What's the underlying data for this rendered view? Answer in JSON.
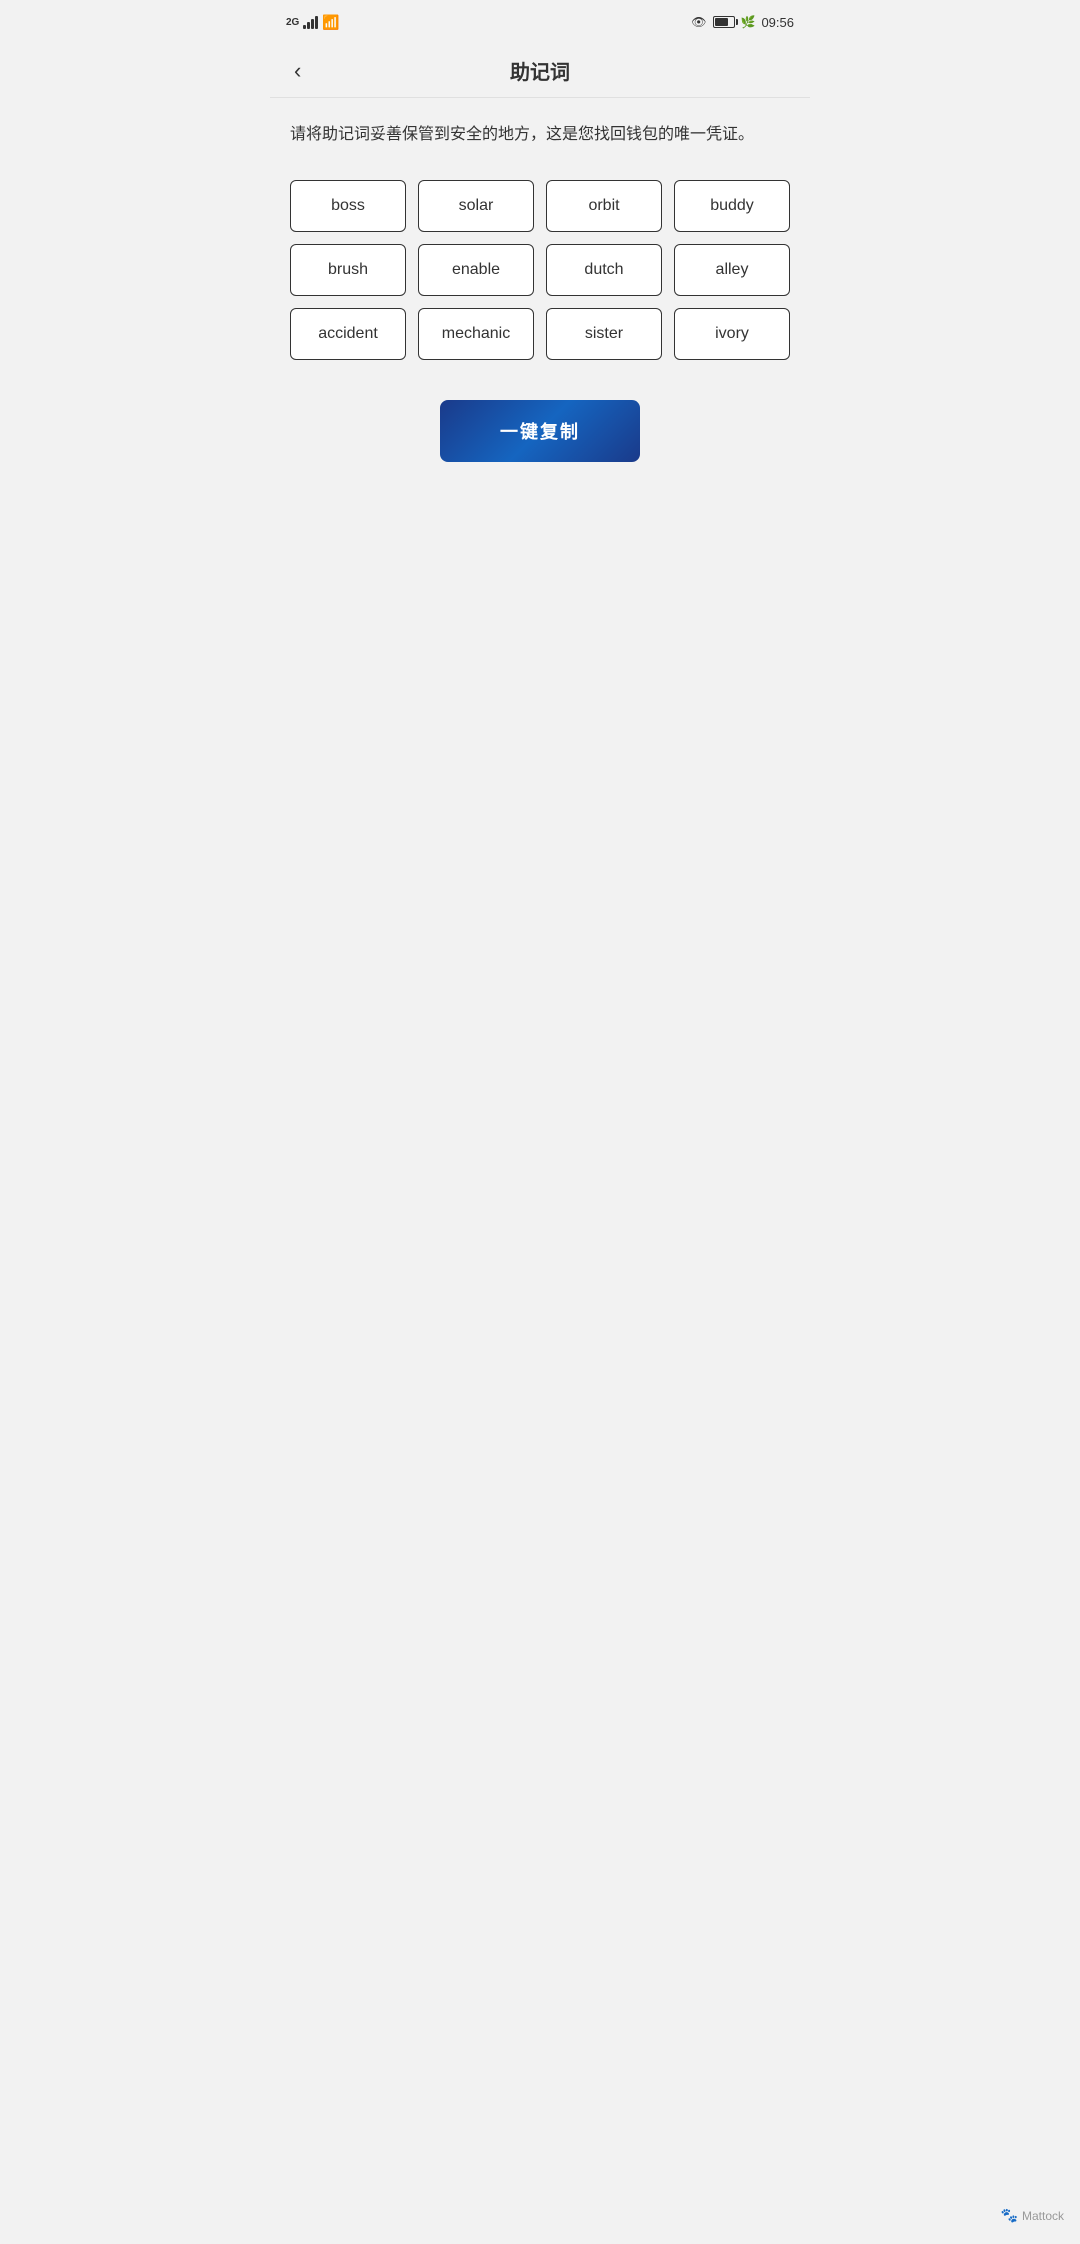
{
  "statusBar": {
    "signal": "2G",
    "time": "09:56",
    "battery": 76
  },
  "header": {
    "backLabel": "‹",
    "title": "助记词"
  },
  "description": "请将助记词妥善保管到安全的地方，这是您找回钱包的唯一凭证。",
  "mnemonicWords": [
    "boss",
    "solar",
    "orbit",
    "buddy",
    "brush",
    "enable",
    "dutch",
    "alley",
    "accident",
    "mechanic",
    "sister",
    "ivory"
  ],
  "copyButton": {
    "label": "一键复制"
  },
  "footer": {
    "brand": "Mattock"
  }
}
